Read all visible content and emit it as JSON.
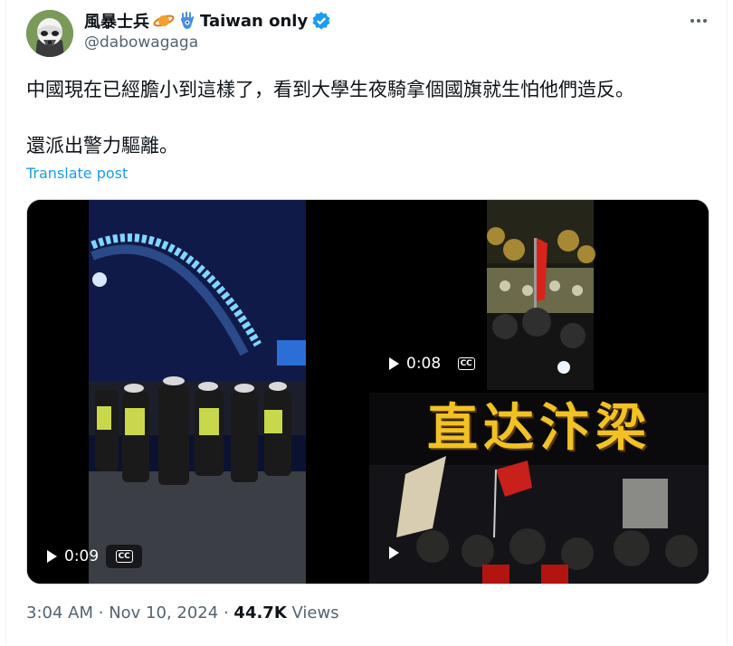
{
  "author": {
    "display_name": "風暴士兵",
    "name_suffix": "Taiwan only",
    "handle": "@dabowagaga"
  },
  "icons": [
    "saturn-emoji-icon",
    "hamsa-emoji-icon",
    "verified-badge-icon",
    "more-icon",
    "play-icon",
    "closed-captions-icon"
  ],
  "post": {
    "text_line1": "中國現在已經膽小到這樣了，看到大學生夜騎拿個國旗就生怕他們造反。",
    "text_line2": "還派出警力驅離。",
    "translate_label": "Translate post"
  },
  "media": {
    "video1": {
      "duration": "0:09"
    },
    "video2": {
      "duration": "0:08"
    },
    "video3": {
      "overlay_title": "直达汴梁"
    }
  },
  "meta": {
    "time": "3:04 AM",
    "date": "Nov 10, 2024",
    "views_count": "44.7K",
    "views_label": "Views",
    "separator": "·"
  },
  "colors": {
    "link": "#1d9bf0",
    "muted": "#536471",
    "verified": "#1d9bf0",
    "overlay_text": "#f2c224"
  }
}
